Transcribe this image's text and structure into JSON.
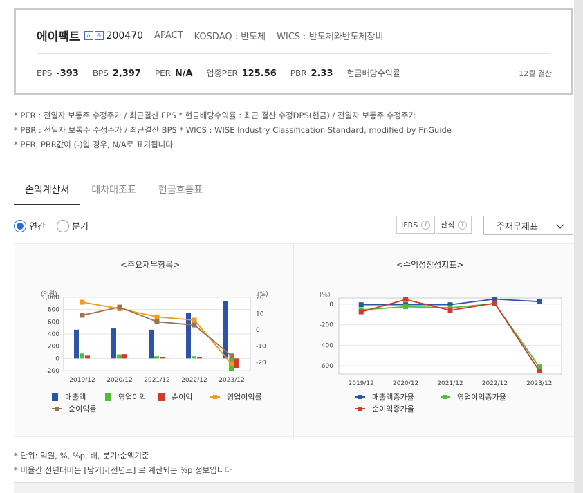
{
  "company": {
    "name": "에이팩트",
    "code": "200470",
    "ticker": "APACT",
    "market": "KOSDAQ : 반도체",
    "wics": "WICS : 반도체와반도체장비",
    "icon1": "building-icon",
    "icon2": "settings-icon"
  },
  "metrics": [
    {
      "label": "EPS",
      "value": "-393"
    },
    {
      "label": "BPS",
      "value": "2,397"
    },
    {
      "label": "PER",
      "value": "N/A"
    },
    {
      "label": "업종PER",
      "value": "125.56"
    },
    {
      "label": "PBR",
      "value": "2.33"
    },
    {
      "label": "현금배당수익률",
      "value": ""
    }
  ],
  "settlement": "12월 결산",
  "notes": [
    "* PER : 전일자 보통주 수정주가 / 최근결산 EPS * 현금배당수익률 : 최근 결산 수정DPS(현금) / 전일자 보통주 수정주가",
    "* PBR : 전일자 보통주 수정주가 / 최근결산 BPS * WICS : WISE Industry Classification Standard, modified by FnGuide",
    "* PER, PBR값이 (-)일 경우, N/A로 표기됩니다."
  ],
  "tabs": [
    "손익계산서",
    "대차대조표",
    "현금흐름표"
  ],
  "period": {
    "annual": "연간",
    "quarter": "분기"
  },
  "options": {
    "ifrs": "IFRS",
    "calc": "산식",
    "qmark": "?",
    "select": "주재무제표"
  },
  "colors": {
    "revenue": "#2c55a6",
    "op": "#4fbe36",
    "net": "#d23a2a",
    "opm": "#f39a1c",
    "npm": "#9c7350"
  },
  "chart1": {
    "title": "<주요재무항목>",
    "left_unit": "(억원)",
    "right_unit": "(%)",
    "left_ticks": [
      "1,000",
      "800",
      "600",
      "400",
      "200",
      "0",
      "-200"
    ],
    "right_ticks": [
      "20",
      "10",
      "0",
      "-10",
      "-20"
    ],
    "legend": [
      "매출액",
      "영업이익",
      "순이익",
      "영업이익률",
      "순이익률"
    ]
  },
  "chart2": {
    "title": "<수익성장성지표>",
    "unit": "(%)",
    "ticks": [
      "0",
      "-200",
      "-400",
      "-600"
    ],
    "legend": [
      "매출액증가율",
      "영업이익증가율",
      "순이익증가율"
    ]
  },
  "chart_data": [
    {
      "type": "bar",
      "title": "<주요재무항목>",
      "categories": [
        "2019/12",
        "2020/12",
        "2021/12",
        "2022/12",
        "2023/12"
      ],
      "ylim": [
        -200,
        1000
      ],
      "y2lim": [
        -25,
        20
      ],
      "series": [
        {
          "name": "매출액",
          "axis": "left",
          "kind": "bar",
          "values": [
            470,
            490,
            470,
            740,
            940
          ]
        },
        {
          "name": "영업이익",
          "axis": "left",
          "kind": "bar",
          "values": [
            80,
            65,
            35,
            35,
            -200
          ]
        },
        {
          "name": "순이익",
          "axis": "left",
          "kind": "bar",
          "values": [
            45,
            70,
            15,
            25,
            -155
          ]
        },
        {
          "name": "영업이익률",
          "axis": "right",
          "kind": "line",
          "values": [
            17,
            13,
            8,
            6,
            -21
          ]
        },
        {
          "name": "순이익률",
          "axis": "right",
          "kind": "line",
          "values": [
            9,
            14,
            5,
            3,
            -16
          ]
        }
      ]
    },
    {
      "type": "line",
      "title": "<수익성장성지표>",
      "categories": [
        "2019/12",
        "2020/12",
        "2021/12",
        "2022/12",
        "2023/12"
      ],
      "ylim": [
        -680,
        60
      ],
      "series": [
        {
          "name": "매출액증가율",
          "values": [
            -5,
            -5,
            -5,
            50,
            25
          ]
        },
        {
          "name": "영업이익증가율",
          "values": [
            -55,
            -25,
            -35,
            5,
            -610
          ]
        },
        {
          "name": "순이익증가율",
          "values": [
            -75,
            45,
            -60,
            10,
            -650
          ]
        }
      ]
    }
  ],
  "footnotes": [
    "* 단위: 억원, %, %p, 배, 분기:순액기준",
    "* 비율간 전년대비는 [당기]-[전년도] 로 계산되는 %p 정보입니다"
  ]
}
